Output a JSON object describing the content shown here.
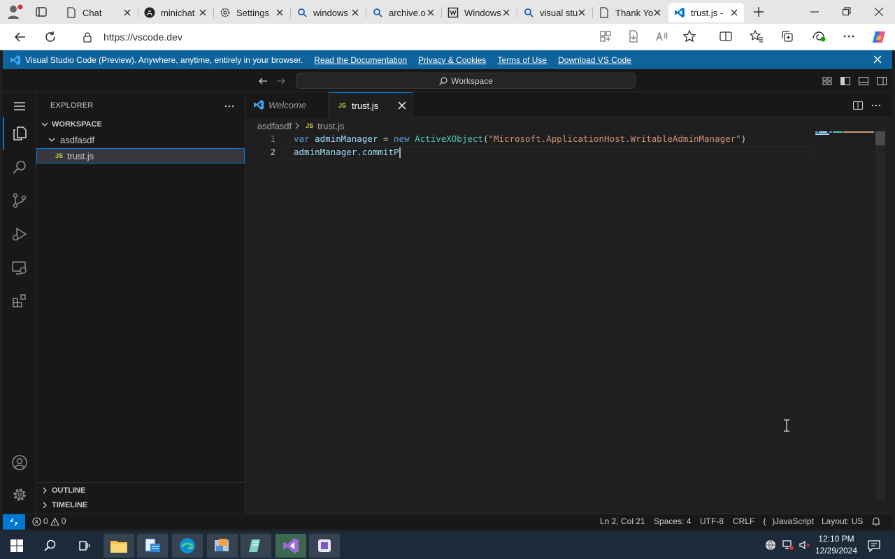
{
  "browser": {
    "tabs": [
      {
        "label": "Chat",
        "icon": "document-icon"
      },
      {
        "label": "minichat",
        "icon": "github-icon"
      },
      {
        "label": "Settings",
        "icon": "gear-icon"
      },
      {
        "label": "windows",
        "icon": "search-icon"
      },
      {
        "label": "archive.o",
        "icon": "search-icon"
      },
      {
        "label": "Windows",
        "icon": "wikipedia-icon"
      },
      {
        "label": "visual stu",
        "icon": "search-icon"
      },
      {
        "label": "Thank Yo",
        "icon": "document-icon"
      },
      {
        "label": "trust.js -",
        "icon": "vscode-icon",
        "active": true
      }
    ],
    "url": "https://vscode.dev"
  },
  "banner": {
    "text": "Visual Studio Code (Preview). Anywhere, anytime, entirely in your browser.",
    "links": [
      "Read the Documentation",
      "Privacy & Cookies",
      "Terms of Use",
      "Download VS Code"
    ]
  },
  "titlebar": {
    "command_center": "Workspace"
  },
  "sidebar": {
    "title": "EXPLORER",
    "workspace": "WORKSPACE",
    "folder": "asdfasdf",
    "file_badge": "JS",
    "file": "trust.js",
    "outline": "OUTLINE",
    "timeline": "TIMELINE"
  },
  "editor": {
    "tabs": [
      {
        "label": "Welcome"
      },
      {
        "label": "trust.js",
        "badge": "JS"
      }
    ],
    "breadcrumb": {
      "folder": "asdfasdf",
      "badge": "JS",
      "file": "trust.js"
    },
    "lines": [
      {
        "num": "1",
        "tokens": [
          "var",
          " adminManager",
          " = ",
          "new",
          " ActiveXObject",
          "(",
          "\"Microsoft.ApplicationHost.WritableAdminManager\"",
          ")"
        ]
      },
      {
        "num": "2",
        "tokens": [
          "adminManager",
          ".",
          "commitP"
        ]
      }
    ]
  },
  "status": {
    "errors": "0",
    "warnings": "0",
    "position": "Ln 2, Col 21",
    "spaces": "Spaces: 4",
    "encoding": "UTF-8",
    "eol": "CRLF",
    "language_braces": "{ }",
    "language": "JavaScript",
    "layout": "Layout: US"
  },
  "clock": {
    "time": "12:10 PM",
    "date": "12/29/2024"
  },
  "colors": {
    "accent": "#0078d4",
    "banner": "#0e639c",
    "string": "#ce9178",
    "keyword": "#569cd6",
    "class": "#4ec9b0",
    "variable": "#9cdcfe"
  }
}
